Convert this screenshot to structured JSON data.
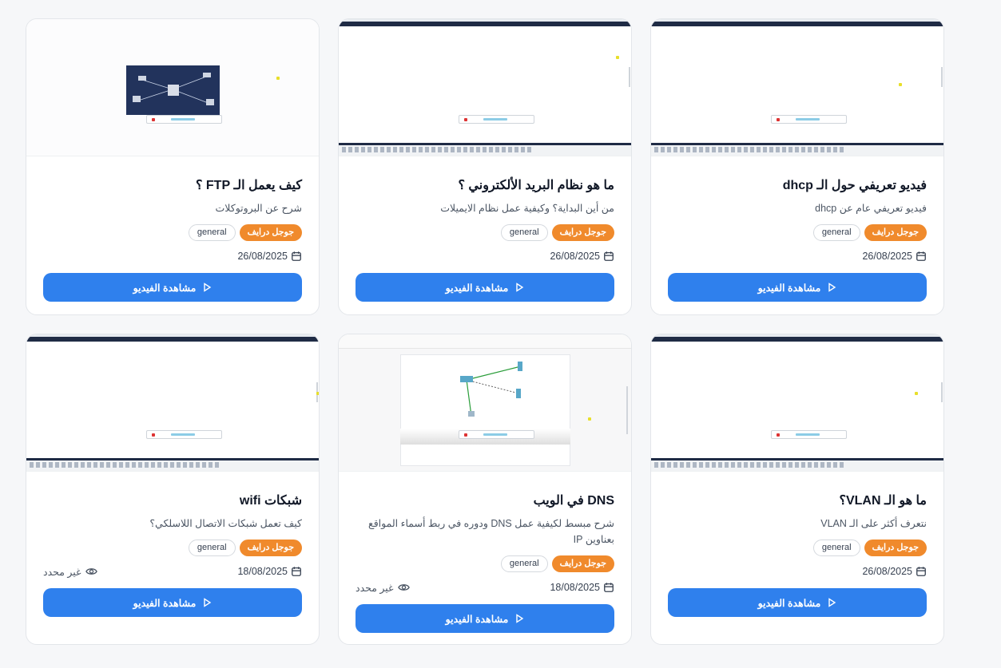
{
  "watch_label": "مشاهدة الفيديو",
  "unknown_views_label": "غير محدد",
  "cards": [
    {
      "title": "فيديو تعريفي حول الـ dhcp",
      "description": "فيديو تعريفي عام عن dhcp",
      "tag_primary": "جوجل درايف",
      "tag_secondary": "general",
      "date": "26/08/2025"
    },
    {
      "title": "ما هو نظام البريد الألكتروني ؟",
      "description": "من أين البداية؟ وكيفية عمل نظام الايميلات",
      "tag_primary": "جوجل درايف",
      "tag_secondary": "general",
      "date": "26/08/2025"
    },
    {
      "title": "كيف يعمل الـ FTP ؟",
      "description": "شرح عن البروتوكلات",
      "tag_primary": "جوجل درايف",
      "tag_secondary": "general",
      "date": "26/08/2025"
    },
    {
      "title": "ما هو الـ VLAN؟",
      "description": "نتعرف أكثر على الـ VLAN",
      "tag_primary": "جوجل درايف",
      "tag_secondary": "general",
      "date": "26/08/2025"
    },
    {
      "title": "DNS في الويب",
      "description": "شرح مبسط لكيفية عمل DNS ودوره في ربط أسماء المواقع بعناوين IP",
      "tag_primary": "جوجل درايف",
      "tag_secondary": "general",
      "date": "18/08/2025",
      "views": "غير محدد"
    },
    {
      "title": "شبكات wifi",
      "description": "كيف تعمل شبكات الاتصال اللاسلكي؟",
      "tag_primary": "جوجل درايف",
      "tag_secondary": "general",
      "date": "18/08/2025",
      "views": "غير محدد"
    }
  ],
  "colors": {
    "primary_button": "#2f80ed",
    "tag_orange": "#f08a2c",
    "card_border": "#e3e6ea",
    "page_background": "#f6f7f9"
  },
  "icons": {
    "date": "calendar-icon",
    "views": "eye-icon",
    "play": "play-icon"
  }
}
